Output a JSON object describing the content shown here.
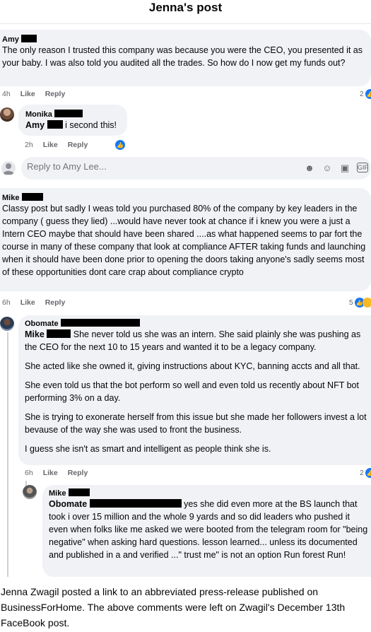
{
  "header": {
    "title": "Jenna's post"
  },
  "comments": {
    "amy": {
      "author": "Amy",
      "text": "The only reason I trusted this company was because you were the CEO, you presented it as your baby. I was also told you audited all the trades. So how do I now get my funds out?",
      "time": "4h",
      "like": "Like",
      "reply": "Reply",
      "reactions": "2"
    },
    "monika": {
      "author": "Monika",
      "mention": "Amy",
      "text": "i second this!",
      "time": "2h",
      "like": "Like",
      "reply": "Reply"
    },
    "reply_box": {
      "placeholder": "Reply to Amy Lee..."
    },
    "mike": {
      "author": "Mike",
      "text": "Classy post but sadly I weas told you purchased 80% of the company by key leaders in the company ( guess they lied) ...would have never took at chance if i knew you were a just a Intern CEO maybe that should have been shared ....as what happened seems to par fort the course in many of these company that look at compliance AFTER taking funds and launching when it should have been done prior to opening the doors taking anyone's sadly seems most of these opportunities dont care crap about compliance crypto",
      "time": "6h",
      "like": "Like",
      "reply": "Reply",
      "reactions": "5"
    },
    "obomate": {
      "author": "Obomate",
      "mention": "Mike",
      "paragraphs": [
        "She never told us she was an intern. She said plainly she was pushing as the CEO for the next 10 to 15 years and wanted it to be a legacy company.",
        "She acted like she owned it, giving instructions about KYC, banning accts and all that.",
        "She even told us that the bot perform so well and even told us recently about NFT bot performing 3% on a day.",
        "She is trying to exonerate herself from this issue but she made her followers invest a lot bevause of the way she was used to front the business.",
        "I guess she isn't as smart and intelligent as people think she is."
      ],
      "time": "6h",
      "like": "Like",
      "reply": "Reply",
      "reactions": "2"
    },
    "mike2": {
      "author": "Mike",
      "mention": "Obomate",
      "text": "yes she did even more at the BS launch that took i over 15 million and the whole 9 yards and so did leaders who pushed it even when folks like me asked we were booted from the telegram room for \"being negative\" when asking hard questions. lesson learned... unless its documented and published in a and verified ...\" trust me\" is not an option Run forest Run!"
    }
  },
  "caption": "Jenna Zwagil posted a link to an abbreviated press-release published on BusinessForHome. The above comments were left on Zwagil's December 13th FaceBook post.",
  "icons": [
    "like-icon",
    "haha-icon",
    "gif-icon",
    "emoji-icon",
    "camera-icon",
    "sticker-icon",
    "avatar-icon"
  ],
  "colors": {
    "bubble": "#f0f2f5",
    "like": "#1877f2",
    "muted": "#65676b"
  }
}
